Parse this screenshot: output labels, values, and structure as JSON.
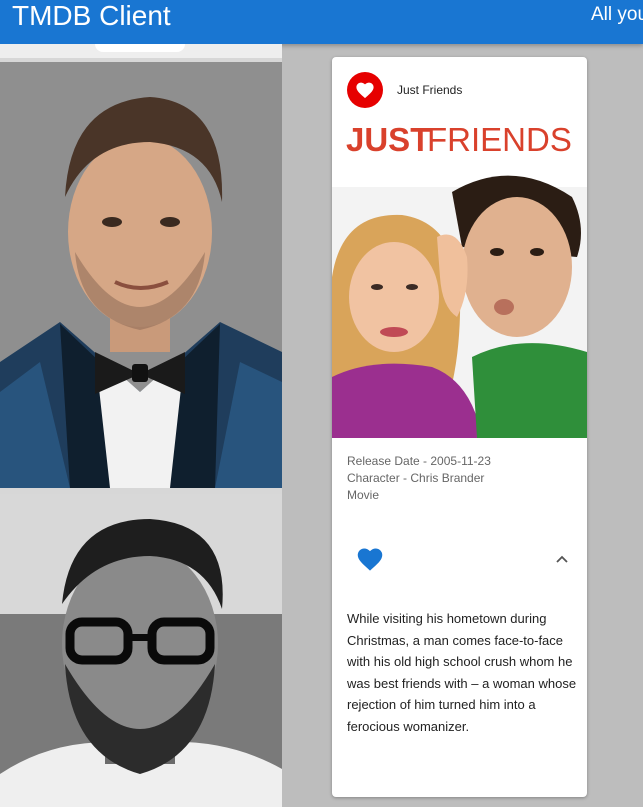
{
  "appbar": {
    "title": "TMDB Client",
    "right_link": "All you"
  },
  "card": {
    "title": "Just Friends",
    "poster_title_word1": "JUST",
    "poster_title_word2": "FRIENDS",
    "release_date": "Release Date - 2005-11-23",
    "character": "Character - Chris Brander",
    "media_type": "Movie",
    "overview": "While visiting his hometown during Christmas, a man comes face-to-face with his old high school crush whom he was best friends with – a woman whose rejection of him turned him into a ferocious womanizer."
  },
  "colors": {
    "appbar": "#1976d2",
    "avatar_red": "#e60000",
    "favorite_blue": "#1976d2",
    "poster_title_red": "#d9412c"
  },
  "icons": {
    "avatar": "heart-icon",
    "favorite": "heart-icon",
    "expand": "chevron-up-icon"
  }
}
